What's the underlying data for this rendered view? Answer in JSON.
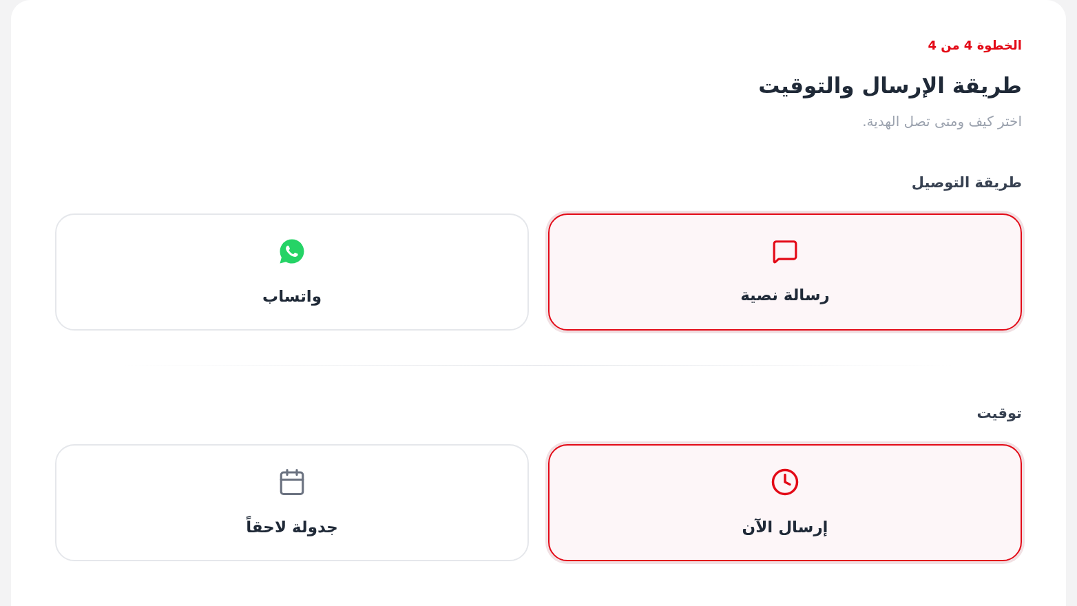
{
  "step": "الخطوة 4 من 4",
  "title": "طريقة الإرسال والتوقيت",
  "subtitle": "اختر كيف ومتى تصل الهدية.",
  "sections": [
    {
      "label": "طريقة التوصيل",
      "options": [
        {
          "kind": "sms",
          "label": "رسالة نصية",
          "selected": true
        },
        {
          "kind": "whatsapp",
          "label": "واتساب",
          "selected": false
        }
      ]
    },
    {
      "label": "توقيت",
      "options": [
        {
          "kind": "now",
          "label": "إرسال الآن",
          "selected": true
        },
        {
          "kind": "schedule",
          "label": "جدولة لاحقاً",
          "selected": false
        }
      ]
    }
  ]
}
